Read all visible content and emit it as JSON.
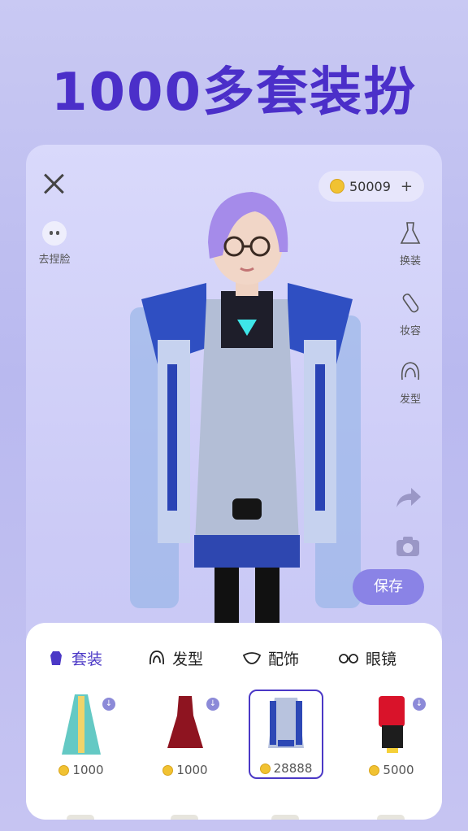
{
  "headline": "1000多套装扮",
  "top_left": {
    "face_label": "去捏脸"
  },
  "currency": {
    "amount": "50009",
    "plus": "+"
  },
  "side_tools": [
    {
      "label": "换装",
      "icon": "dress-icon"
    },
    {
      "label": "妆容",
      "icon": "makeup-icon"
    },
    {
      "label": "发型",
      "icon": "hair-icon"
    }
  ],
  "actions": {
    "save_label": "保存",
    "share_icon": "share-arrow-icon",
    "camera_icon": "camera-icon"
  },
  "tabs": [
    {
      "label": "套装",
      "icon": "outfit-icon",
      "active": true
    },
    {
      "label": "发型",
      "icon": "hairstyle-icon",
      "active": false
    },
    {
      "label": "配饰",
      "icon": "accessory-icon",
      "active": false
    },
    {
      "label": "眼镜",
      "icon": "glasses-icon",
      "active": false
    }
  ],
  "items": [
    {
      "name": "teal-dress",
      "price": "1000",
      "selected": false,
      "downloadable": true
    },
    {
      "name": "red-dress",
      "price": "1000",
      "selected": false,
      "downloadable": true
    },
    {
      "name": "blue-tech-outfit",
      "price": "28888",
      "selected": true,
      "downloadable": false
    },
    {
      "name": "red-sweater-outfit",
      "price": "5000",
      "selected": false,
      "downloadable": true
    }
  ],
  "colors": {
    "accent": "#4b38c6",
    "save_button": "#8a83e6",
    "background": "#c9c9f3"
  }
}
